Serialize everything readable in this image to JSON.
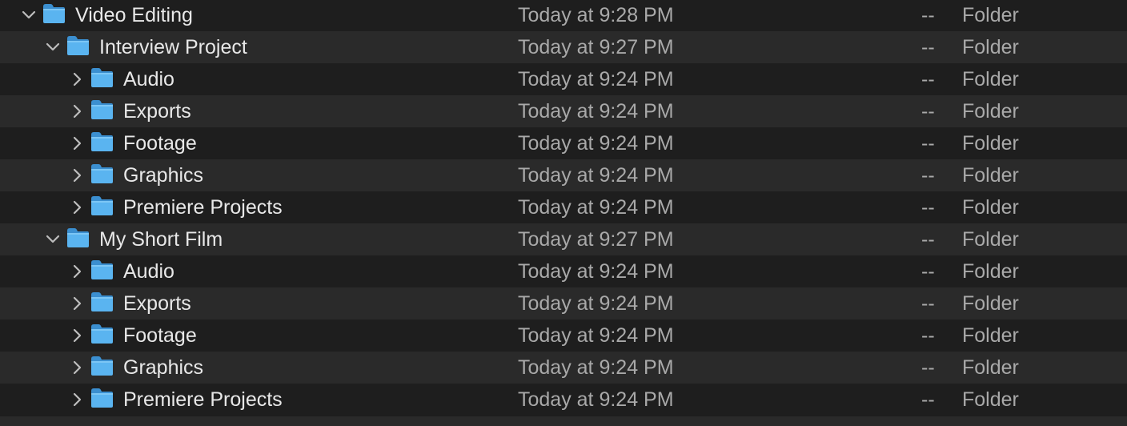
{
  "rows": [
    {
      "name": "Video Editing",
      "date": "Today at 9:28 PM",
      "size": "--",
      "kind": "Folder",
      "level": 0,
      "expanded": true
    },
    {
      "name": "Interview Project",
      "date": "Today at 9:27 PM",
      "size": "--",
      "kind": "Folder",
      "level": 1,
      "expanded": true
    },
    {
      "name": "Audio",
      "date": "Today at 9:24 PM",
      "size": "--",
      "kind": "Folder",
      "level": 2,
      "expanded": false
    },
    {
      "name": "Exports",
      "date": "Today at 9:24 PM",
      "size": "--",
      "kind": "Folder",
      "level": 2,
      "expanded": false
    },
    {
      "name": "Footage",
      "date": "Today at 9:24 PM",
      "size": "--",
      "kind": "Folder",
      "level": 2,
      "expanded": false
    },
    {
      "name": "Graphics",
      "date": "Today at 9:24 PM",
      "size": "--",
      "kind": "Folder",
      "level": 2,
      "expanded": false
    },
    {
      "name": "Premiere Projects",
      "date": "Today at 9:24 PM",
      "size": "--",
      "kind": "Folder",
      "level": 2,
      "expanded": false
    },
    {
      "name": "My Short Film",
      "date": "Today at 9:27 PM",
      "size": "--",
      "kind": "Folder",
      "level": 1,
      "expanded": true
    },
    {
      "name": "Audio",
      "date": "Today at 9:24 PM",
      "size": "--",
      "kind": "Folder",
      "level": 2,
      "expanded": false
    },
    {
      "name": "Exports",
      "date": "Today at 9:24 PM",
      "size": "--",
      "kind": "Folder",
      "level": 2,
      "expanded": false
    },
    {
      "name": "Footage",
      "date": "Today at 9:24 PM",
      "size": "--",
      "kind": "Folder",
      "level": 2,
      "expanded": false
    },
    {
      "name": "Graphics",
      "date": "Today at 9:24 PM",
      "size": "--",
      "kind": "Folder",
      "level": 2,
      "expanded": false
    },
    {
      "name": "Premiere Projects",
      "date": "Today at 9:24 PM",
      "size": "--",
      "kind": "Folder",
      "level": 2,
      "expanded": false
    }
  ],
  "icons": {
    "folder": "folder-icon",
    "expanded": "chevron-down-icon",
    "collapsed": "chevron-right-icon"
  },
  "colors": {
    "row_dark": "#1e1e1e",
    "row_light": "#2a2a2a",
    "folder_blue": "#5ab4f0",
    "name_text": "#e8e8e8",
    "meta_text": "#a9a9a9"
  }
}
